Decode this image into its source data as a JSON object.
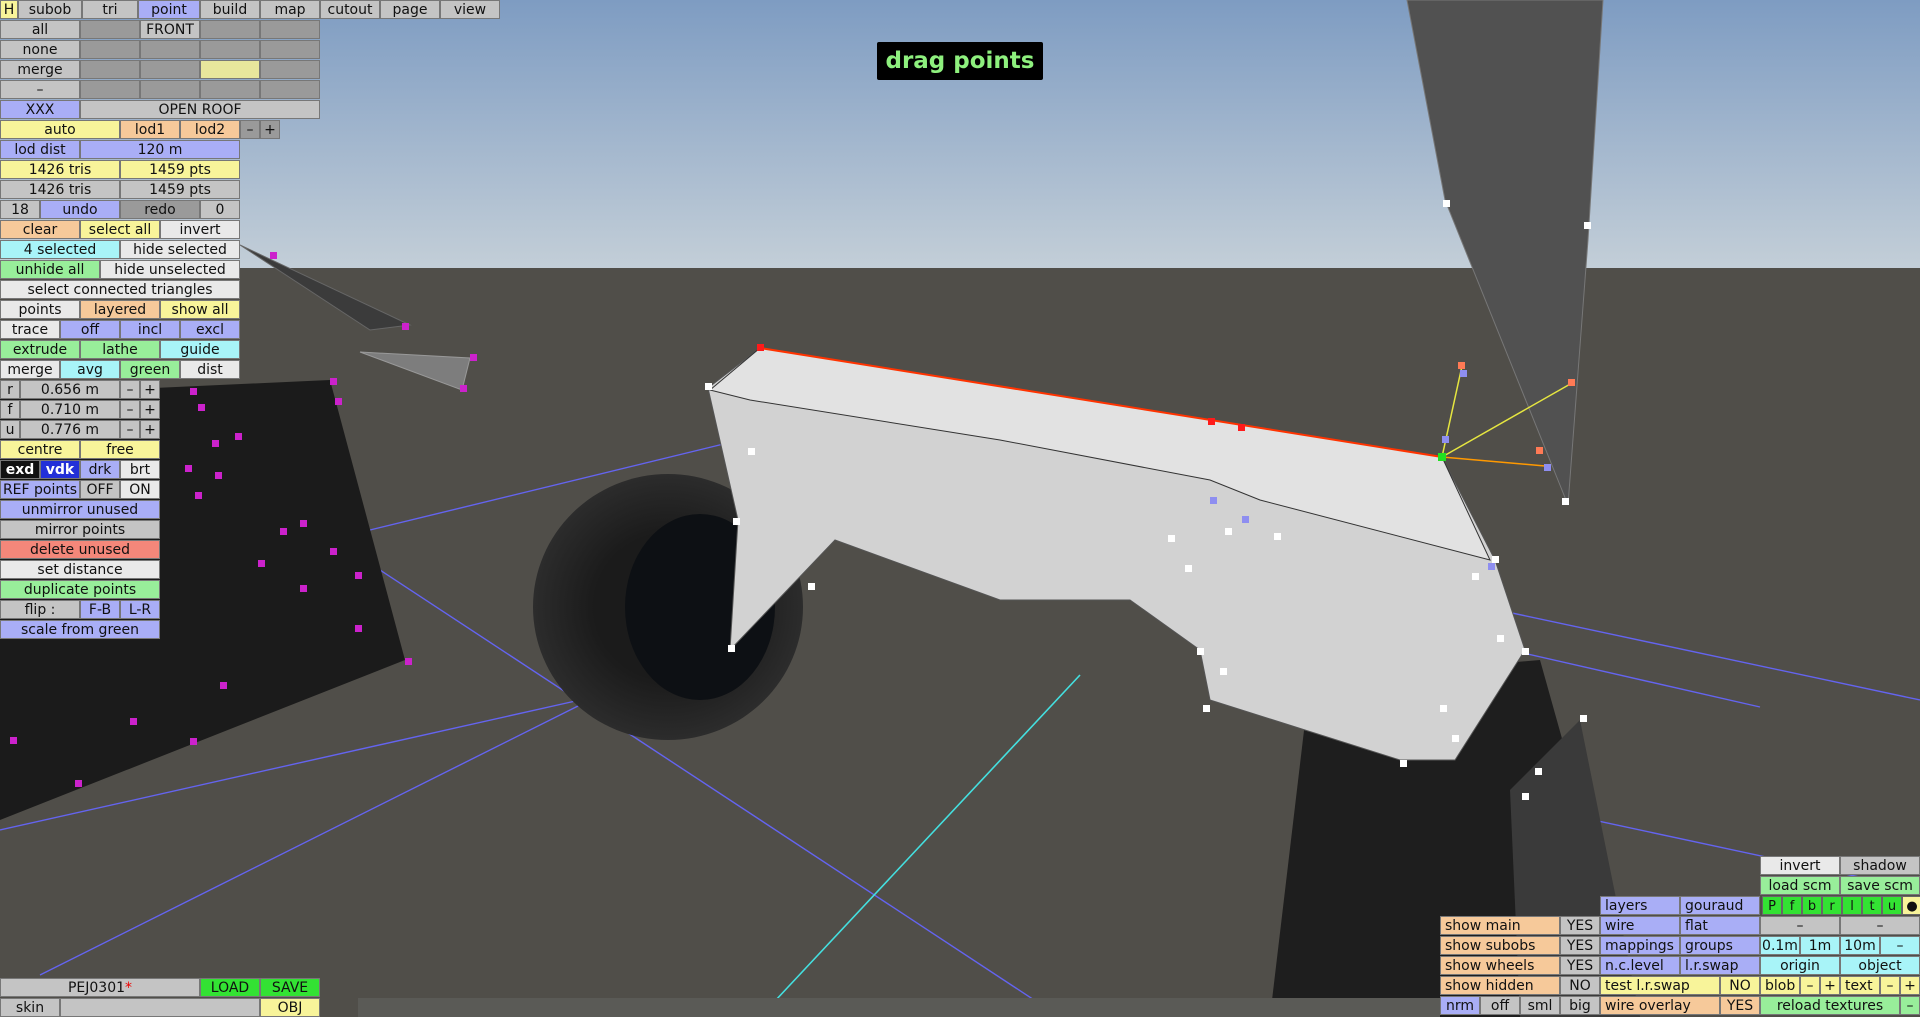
{
  "hint": "drag points",
  "file": {
    "name": "PEJ0301",
    "modified_mark": "*",
    "load": "LOAD",
    "save": "SAVE",
    "skin": "skin",
    "obj": "OBJ"
  },
  "tabs": {
    "h": "H",
    "subob": "subob",
    "tri": "tri",
    "point": "point",
    "build": "build",
    "map": "map",
    "cutout": "cutout",
    "page": "page",
    "view": "view"
  },
  "grid": {
    "all": "all",
    "front": "FRONT",
    "none": "none",
    "merge": "merge",
    "dash": "–",
    "xxx": "XXX",
    "open_roof": "OPEN ROOF"
  },
  "lod": {
    "auto": "auto",
    "lod1": "lod1",
    "lod2": "lod2",
    "minus": "–",
    "plus": "+",
    "dist_label": "lod dist",
    "dist_value": "120 m"
  },
  "stats": {
    "tris1": "1426 tris",
    "pts1": "1459 pts",
    "tris2": "1426 tris",
    "pts2": "1459 pts"
  },
  "history": {
    "count": "18",
    "undo": "undo",
    "redo": "redo",
    "redo_count": "0"
  },
  "select": {
    "clear": "clear",
    "select_all": "select all",
    "invert": "invert",
    "selected": "4 selected",
    "hide_selected": "hide selected",
    "unhide_all": "unhide all",
    "hide_unselected": "hide unselected",
    "connected": "select connected triangles"
  },
  "points_row": {
    "points": "points",
    "layered": "layered",
    "show_all": "show all"
  },
  "trace_row": {
    "trace": "trace",
    "off": "off",
    "incl": "incl",
    "excl": "excl"
  },
  "tools_row": {
    "extrude": "extrude",
    "lathe": "lathe",
    "guide": "guide"
  },
  "merge_row": {
    "merge": "merge",
    "avg": "avg",
    "green": "green",
    "dist": "dist"
  },
  "params": [
    {
      "k": "r",
      "v": "0.656 m"
    },
    {
      "k": "f",
      "v": "0.710 m"
    },
    {
      "k": "u",
      "v": "0.776 m"
    }
  ],
  "param_minus": "–",
  "param_plus": "+",
  "centre_row": {
    "centre": "centre",
    "free": "free"
  },
  "view_mode": {
    "exd": "exd",
    "vdk": "vdk",
    "drk": "drk",
    "brt": "brt"
  },
  "ref_row": {
    "label": "REF points",
    "off": "OFF",
    "on": "ON"
  },
  "actions": {
    "unmirror": "unmirror unused",
    "mirror": "mirror points",
    "delete": "delete unused",
    "set_distance": "set distance",
    "duplicate": "duplicate points",
    "flip": "flip :",
    "fb": "F-B",
    "lr": "L-R",
    "scale": "scale from green"
  },
  "bottom_right": {
    "invert": "invert",
    "shadow": "shadow",
    "load_scm": "load scm",
    "save_scm": "save scm",
    "layers": "layers",
    "gouraud": "gouraud",
    "wire": "wire",
    "flat": "flat",
    "mappings": "mappings",
    "groups": "groups",
    "nclevel": "n.c.level",
    "lrswap": "l.r.swap",
    "test_lrswap": "test l.r.swap",
    "test_val": "NO",
    "wire_overlay": "wire overlay",
    "wire_overlay_val": "YES",
    "letters": [
      "P",
      "f",
      "b",
      "r",
      "l",
      "t",
      "u",
      "●"
    ],
    "dash": "–",
    "steps": [
      "0.1m",
      "1m",
      "10m",
      "–"
    ],
    "origin": "origin",
    "object": "object",
    "blob": "blob",
    "text": "text",
    "minus": "–",
    "plus": "+",
    "reload": "reload textures",
    "reload_dash": "–"
  },
  "show": [
    {
      "label": "show main",
      "value": "YES"
    },
    {
      "label": "show subobs",
      "value": "YES"
    },
    {
      "label": "show wheels",
      "value": "YES"
    },
    {
      "label": "show hidden",
      "value": "NO"
    }
  ],
  "render_size": {
    "nrm": "nrm",
    "off": "off",
    "sml": "sml",
    "big": "big"
  },
  "colors": {
    "sky_top": "#87a2c2",
    "ground": "#504e49",
    "mesh": "#d8d8d8",
    "highlight": "#ff2a00",
    "magenta_points": "#cc22cc",
    "axis_blue": "#6060ff"
  }
}
